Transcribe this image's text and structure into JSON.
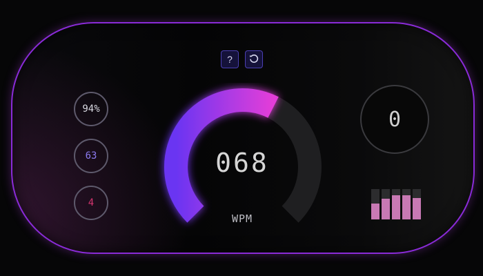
{
  "controls": {
    "help_label": "?",
    "reset_icon": "reset-icon"
  },
  "stats": {
    "accuracy": "94%",
    "chars": "63",
    "errors": "4"
  },
  "gauge": {
    "wpm_value": "068",
    "wpm_label": "WPM",
    "progress_fraction": 0.6,
    "colors": {
      "start": "#6a35f2",
      "end": "#e43ed8",
      "track": "#1f1f21"
    }
  },
  "counter": {
    "value": "0"
  },
  "bars": {
    "fill_fractions": [
      0.52,
      0.68,
      0.79,
      0.79,
      0.7
    ],
    "colors": {
      "fill": "#c879b4",
      "track": "#2c2c2e"
    }
  }
}
